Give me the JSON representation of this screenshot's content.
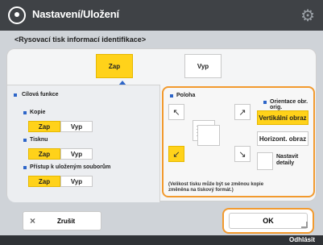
{
  "titlebar": {
    "title": "Nastavení/Uložení"
  },
  "breadcrumb": "<Rysovací tisk informací identifikace>",
  "top_toggle": {
    "on_label": "Zap",
    "off_label": "Vyp"
  },
  "left_section": {
    "header": "Cílová funkce",
    "copy_label": "Kopie",
    "print_label": "Tisknu",
    "access_label": "Přístup k uloženým souborům",
    "on_label": "Zap",
    "off_label": "Vyp"
  },
  "right_section": {
    "position_label": "Poloha",
    "orientation_label": "Orientace obr. orig.",
    "vertical_label": "Vertikální obraz",
    "horizontal_label": "Horizont. obraz",
    "details_label": "Nastavit detaily",
    "note": "(Velikost tisku může být se změnou kopie změněna na tiskový formát.)"
  },
  "bottom": {
    "cancel_label": "Zrušit",
    "ok_label": "OK"
  },
  "footer": {
    "status": "Odhlásit"
  }
}
